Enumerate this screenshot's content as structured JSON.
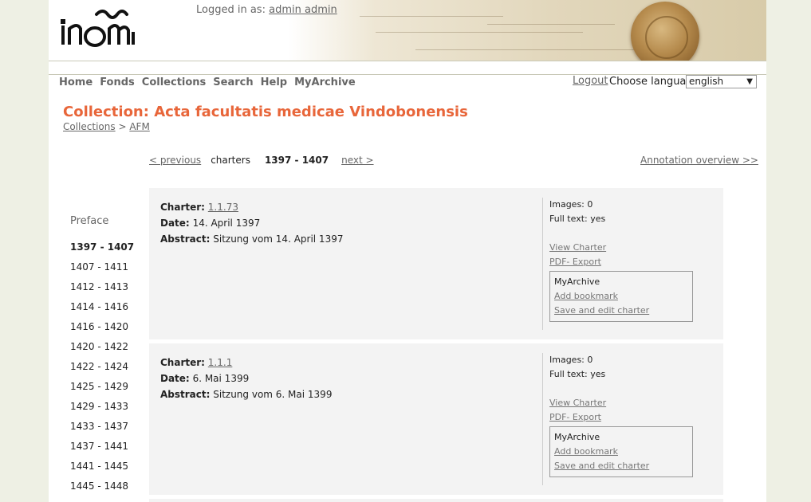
{
  "header": {
    "logged_in_label": "Logged in as:",
    "user_name": "admin admin"
  },
  "nav": {
    "items": [
      "Home",
      "Fonds",
      "Collections",
      "Search",
      "Help",
      "MyArchive"
    ],
    "logout": "Logout",
    "choose_language": "Choose language",
    "language_value": "english"
  },
  "page": {
    "title": "Collection: Acta facultatis medicae Vindobonensis",
    "breadcrumb": [
      "Collections",
      ">",
      "AFM"
    ]
  },
  "pager": {
    "previous": "< previous",
    "label": "charters",
    "range": "1397 - 1407",
    "next": "next >",
    "annotation_overview": "Annotation overview  >>"
  },
  "sidebar": {
    "preface": "Preface",
    "ranges": [
      "1397 - 1407",
      "1407 - 1411",
      "1412 - 1413",
      "1414 - 1416",
      "1416 - 1420",
      "1420 - 1422",
      "1422 - 1424",
      "1425 - 1429",
      "1429 - 1433",
      "1433 - 1437",
      "1437 - 1441",
      "1441 - 1445",
      "1445 - 1448"
    ],
    "active_index": 0
  },
  "charter_labels": {
    "charter": "Charter:",
    "date": "Date:",
    "abstract": "Abstract:",
    "images": "Images:",
    "full_text": "Full text:",
    "view_charter": "View Charter",
    "pdf_export": "PDF- Export",
    "myarchive": "MyArchive",
    "add_bookmark": "Add bookmark",
    "save_edit": "Save and edit charter"
  },
  "charters": [
    {
      "id": "1.1.73",
      "date": "14. April 1397",
      "abstract": "Sitzung vom 14. April 1397",
      "images": "0",
      "full_text": "yes"
    },
    {
      "id": "1.1.1",
      "date": "6. Mai 1399",
      "abstract": "Sitzung vom 6. Mai 1399",
      "images": "0",
      "full_text": "yes"
    }
  ],
  "colors": {
    "title": "#e8663a",
    "link": "#666666",
    "panel": "#f3f3f3",
    "page_bg": "#eef0e4"
  }
}
